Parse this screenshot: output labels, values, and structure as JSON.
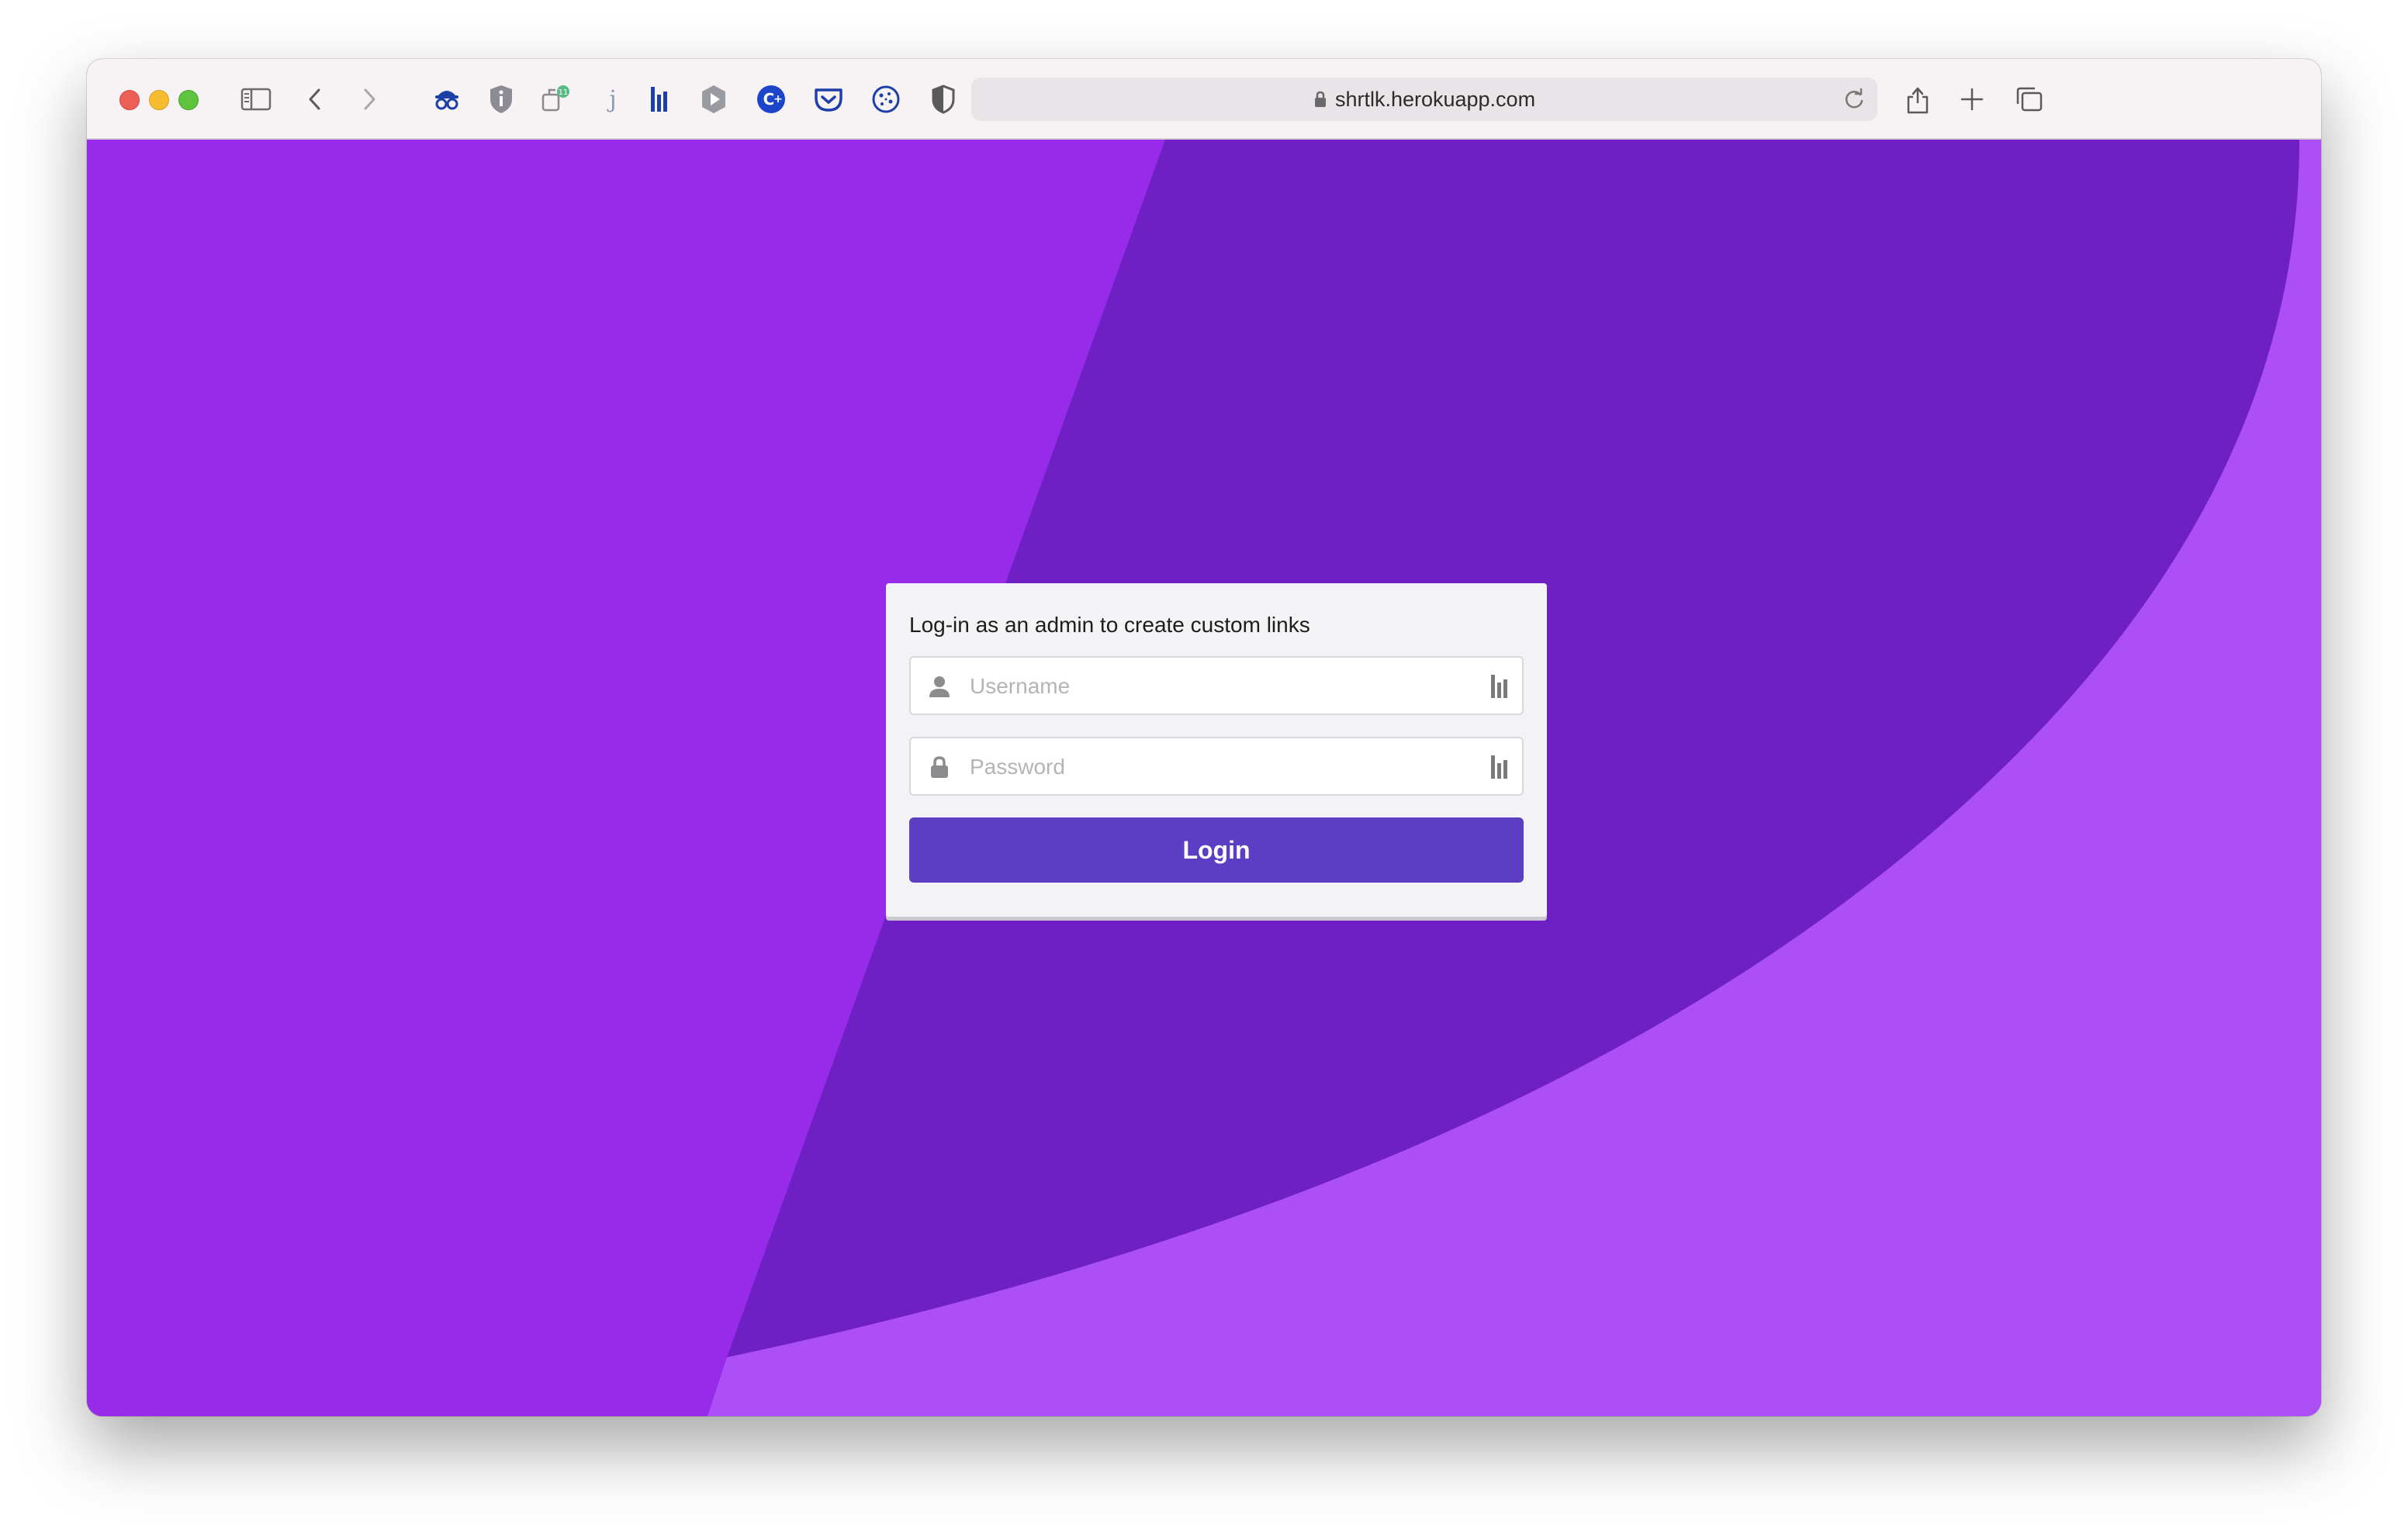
{
  "browser": {
    "url": "shrtlk.herokuapp.com",
    "toolbar_icons": [
      "sidebar-icon",
      "back-icon",
      "forward-icon",
      "spy-extension-icon",
      "info-shield-extension-icon",
      "extension-badge-icon",
      "j-extension-icon",
      "bitwarden-bars-icon",
      "play-extension-icon",
      "c-plus-extension-icon",
      "pocket-icon",
      "cookie-icon",
      "privacy-shield-icon",
      "share-icon",
      "new-tab-icon",
      "tab-overview-icon"
    ]
  },
  "login_card": {
    "title": "Log-in as an admin to create custom links",
    "username_placeholder": "Username",
    "password_placeholder": "Password",
    "login_label": "Login"
  },
  "colors": {
    "background_left": "#982be9",
    "background_band": "#6e20c4",
    "background_right": "#ac4ff6",
    "button": "#5c3ec4",
    "card": "#f3f3f6"
  }
}
